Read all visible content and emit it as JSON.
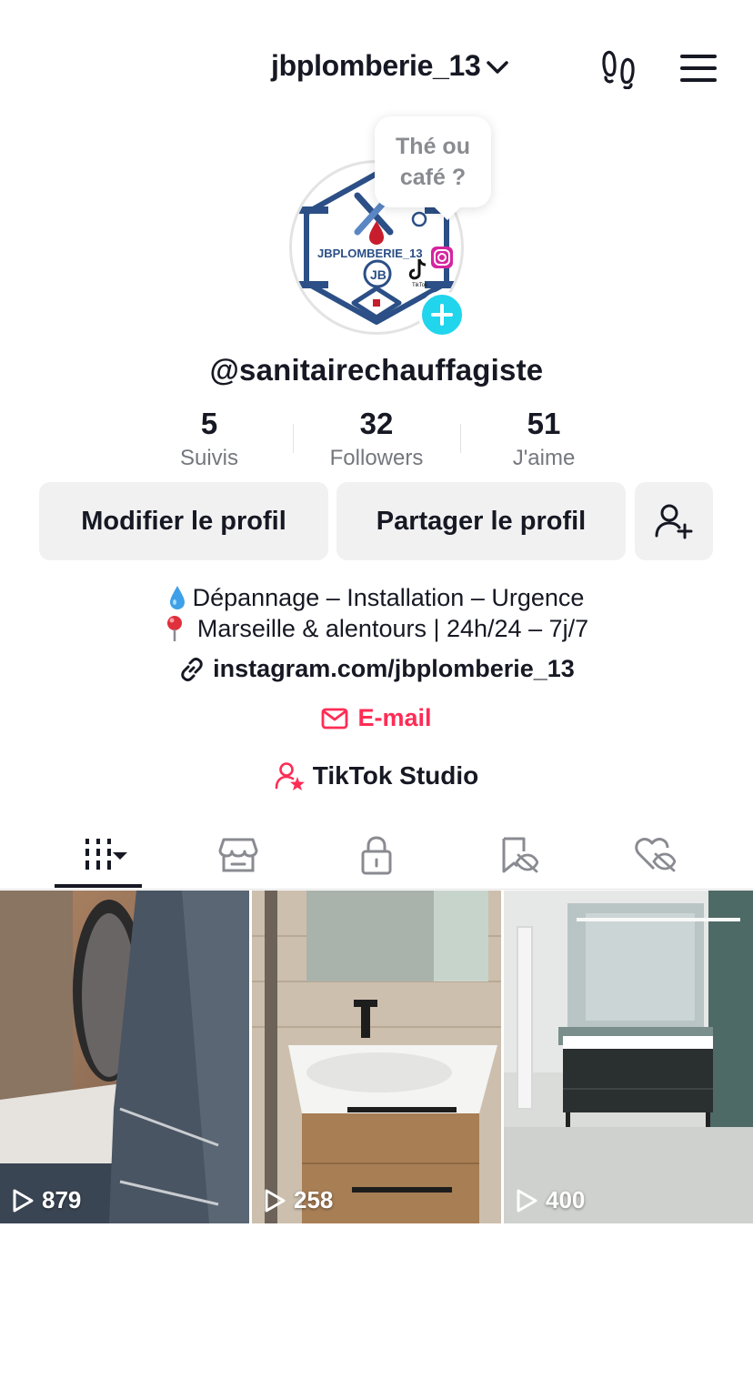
{
  "header": {
    "username": "jbplomberie_13",
    "icons": [
      "chevron-down-icon",
      "footprints-icon",
      "hamburger-menu-icon"
    ]
  },
  "profile": {
    "avatar_texts": {
      "brand": "JBPLOMBERIE_13",
      "monogram": "JB",
      "tiktok": "TikTok"
    },
    "note_bubble": "Thé ou café ?",
    "handle": "@sanitairechauffagiste"
  },
  "stats": [
    {
      "value": "5",
      "label": "Suivis"
    },
    {
      "value": "32",
      "label": "Followers"
    },
    {
      "value": "51",
      "label": "J'aime"
    }
  ],
  "actions": {
    "edit": "Modifier le profil",
    "share": "Partager le profil",
    "add_friend_icon": "add-user-icon"
  },
  "bio": {
    "line1": "Dépannage – Installation – Urgence",
    "line2": "Marseille & alentours | 24h/24 – 7j/7",
    "link": "instagram.com/jbplomberie_13",
    "email": "E-mail",
    "studio": "TikTok Studio"
  },
  "tabs": [
    {
      "name": "videos",
      "icon": "grid-icon",
      "active": true
    },
    {
      "name": "shop",
      "icon": "shop-icon",
      "active": false
    },
    {
      "name": "private",
      "icon": "lock-icon",
      "active": false
    },
    {
      "name": "saved",
      "icon": "bookmark-hidden-icon",
      "active": false
    },
    {
      "name": "liked",
      "icon": "heart-hidden-icon",
      "active": false
    }
  ],
  "videos": [
    {
      "views": "879"
    },
    {
      "views": "258"
    },
    {
      "views": "400"
    }
  ],
  "colors": {
    "accent_red": "#fe2c55",
    "accent_cyan": "#20d5ec",
    "text_primary": "#161823",
    "text_secondary": "#75777e",
    "button_bg": "#f1f1f2"
  }
}
